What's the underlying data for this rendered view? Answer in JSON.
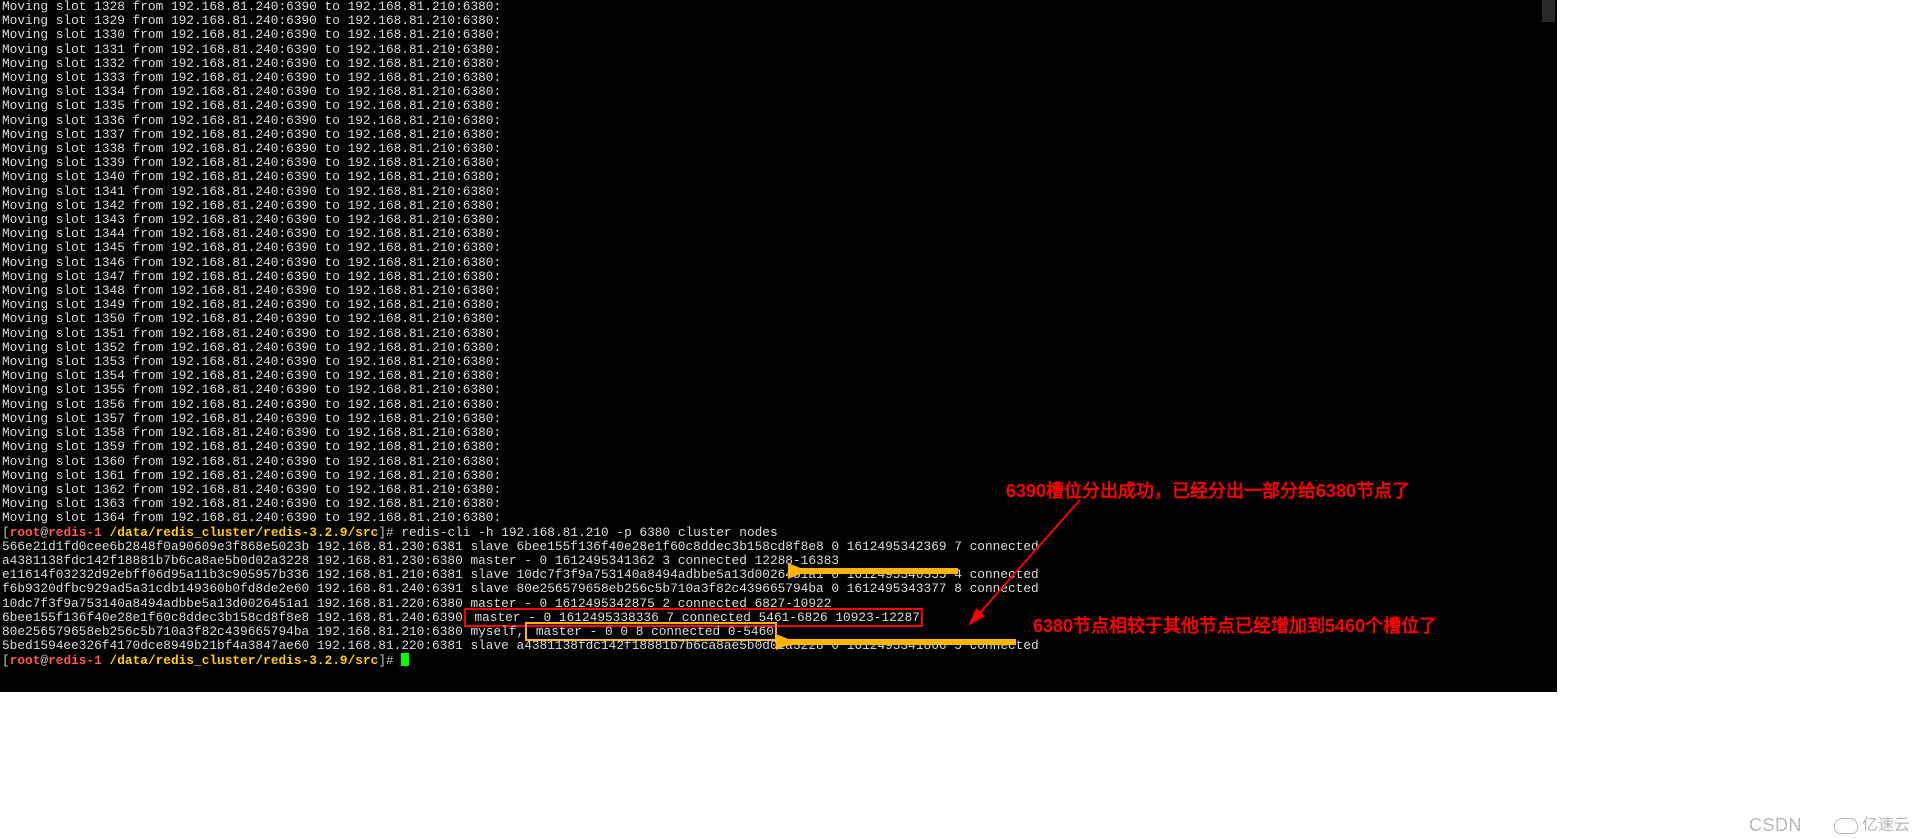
{
  "terminal": {
    "moving_slots": {
      "start": 1328,
      "end": 1364,
      "from": "192.168.81.240:6390",
      "to": "192.168.81.210:6380"
    },
    "prompt": {
      "user": "root",
      "host": "redis-1",
      "path": "/data/redis_cluster/redis-3.2.9/src",
      "open": "[",
      "close": "]#"
    },
    "command": " redis-cli -h 192.168.81.210 -p 6380 cluster nodes",
    "nodes": [
      {
        "text": "566e21d1fd0cee6b2848f0a90609e3f868e5023b 192.168.81.230:6381 slave 6bee155f136f40e28e1f60c8ddec3b158cd8f8e8 0 1612495342369 7 connected"
      },
      {
        "text": "a4381138fdc142f18881b7b6ca8ae5b0d02a3228 192.168.81.230:6380 master - 0 1612495341362 3 connected 12288-16383",
        "arrow_yellow_top": true
      },
      {
        "text": "e11614f03232d92ebff06d95a11b3c905957b336 192.168.81.210:6381 slave 10dc7f3f9a753140a8494adbbe5a13d0026451a1 0 1612495340355 4 connected"
      },
      {
        "text": "f6b9320dfbc929ad5a31cdb149360b0fd8de2e60 192.168.81.240:6391 slave 80e256579658eb256c5b710a3f82c439665794ba 0 1612495343377 8 connected"
      },
      {
        "text": "10dc7f3f9a753140a8494adbbe5a13d0026451a1 192.168.81.220:6380 master - 0 1612495342875 2 connected 6827-10922"
      },
      {
        "prefix": "6bee155f136f40e28e1f60c8ddec3b158cd8f8e8 192.168.81.240:6390",
        "hl_red": " master - 0 1612495338336 7 connected 5461-6826 10923-12287"
      },
      {
        "prefix": "80e256579658eb256c5b710a3f82c439665794ba 192.168.81.210:6380 myself,",
        "hl_yellow": " master - 0 0 8 connected 0-5460"
      },
      {
        "text": "5bed1594ee326f4170dce8949b21bf4a3847ae60 192.168.81.220:6381 slave a4381138fdc142f18881b7b6ca8ae5b0d02a3228 0 1612495341866 5 connected"
      }
    ]
  },
  "annotations": {
    "top": "6390槽位分出成功，已经分出一部分给6380节点了",
    "bottom": "6380节点相较于其他节点已经增加到5460个槽位了"
  },
  "watermarks": {
    "csdn": "CSDN",
    "yisu": "亿速云"
  }
}
